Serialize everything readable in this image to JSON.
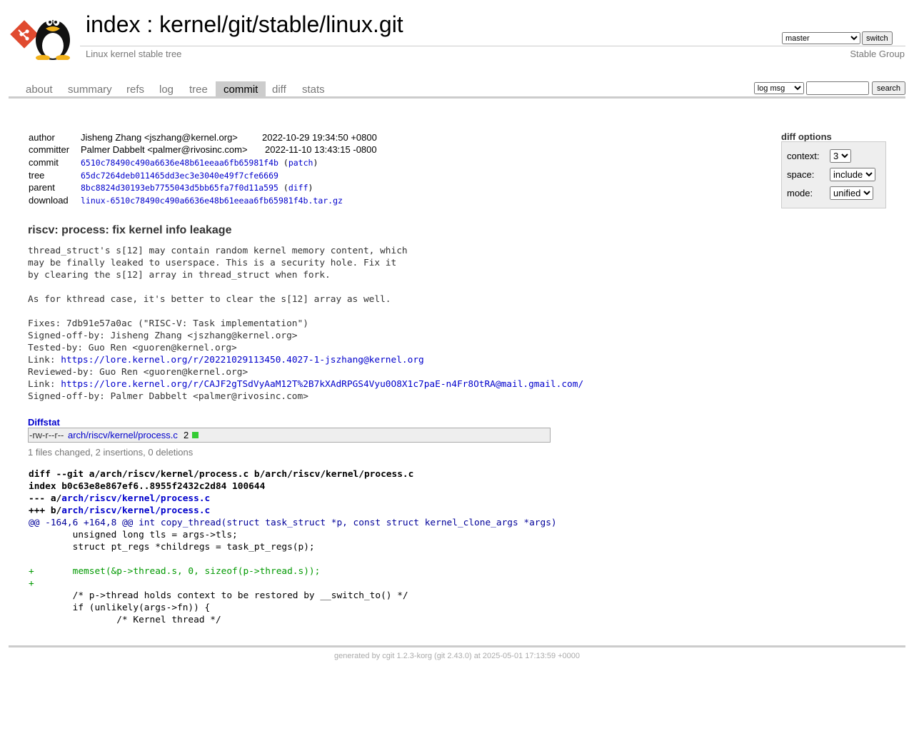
{
  "header": {
    "title_index": "index",
    "title_sep": " : ",
    "title_repo": "kernel/git/stable/linux.git",
    "subtitle": "Linux kernel stable tree",
    "owner": "Stable Group",
    "branch_selected": "master",
    "switch_label": "switch"
  },
  "tabs": [
    {
      "label": "about"
    },
    {
      "label": "summary"
    },
    {
      "label": "refs"
    },
    {
      "label": "log"
    },
    {
      "label": "tree"
    },
    {
      "label": "commit"
    },
    {
      "label": "diff"
    },
    {
      "label": "stats"
    }
  ],
  "active_tab": "commit",
  "search": {
    "select_value": "log msg",
    "query": "",
    "button_label": "search"
  },
  "commit_info": {
    "author_label": "author",
    "author": "Jisheng Zhang <jszhang@kernel.org>",
    "author_date": "2022-10-29 19:34:50 +0800",
    "committer_label": "committer",
    "committer": "Palmer Dabbelt <palmer@rivosinc.com>",
    "committer_date": "2022-11-10 13:43:15 -0800",
    "commit_label": "commit",
    "commit": "6510c78490c490a6636e48b61eeaa6fb65981f4b",
    "patch_link": "patch",
    "tree_label": "tree",
    "tree": "65dc7264deb011465dd3ec3e3040e49f7cfe6669",
    "parent_label": "parent",
    "parent": "8bc8824d30193eb7755043d5bb65fa7f0d11a595",
    "diff_link": "diff",
    "download_label": "download",
    "download": "linux-6510c78490c490a6636e48b61eeaa6fb65981f4b.tar.gz"
  },
  "diff_options": {
    "title": "diff options",
    "context_label": "context:",
    "context_value": "3",
    "space_label": "space:",
    "space_value": "include",
    "mode_label": "mode:",
    "mode_value": "unified"
  },
  "commit_subject": "riscv: process: fix kernel info leakage",
  "commit_message": {
    "line1": "thread_struct's s[12] may contain random kernel memory content, which",
    "line2": "may be finally leaked to userspace. This is a security hole. Fix it",
    "line3": "by clearing the s[12] array in thread_struct when fork.",
    "line4": "As for kthread case, it's better to clear the s[12] array as well.",
    "fixes": "Fixes: 7db91e57a0ac (\"RISC-V: Task implementation\")",
    "signed1": "Signed-off-by: Jisheng Zhang <jszhang@kernel.org>",
    "tested": "Tested-by: Guo Ren <guoren@kernel.org>",
    "link1_prefix": "Link: ",
    "link1": "https://lore.kernel.org/r/20221029113450.4027-1-jszhang@kernel.org",
    "reviewed": "Reviewed-by: Guo Ren <guoren@kernel.org>",
    "link2_prefix": "Link: ",
    "link2": "https://lore.kernel.org/r/CAJF2gTSdVyAaM12T%2B7kXAdRPGS4Vyu0O8X1c7paE-n4Fr8OtRA@mail.gmail.com/",
    "signed2": "Signed-off-by: Palmer Dabbelt <palmer@rivosinc.com>"
  },
  "diffstat": {
    "header": "Diffstat",
    "mode": "-rw-r--r--",
    "file": "arch/riscv/kernel/process.c",
    "count": "2",
    "summary": "1 files changed, 2 insertions, 0 deletions"
  },
  "diff": {
    "line1": "diff --git a/arch/riscv/kernel/process.c b/arch/riscv/kernel/process.c",
    "line2": "index b0c63e8e867ef6..8955f2432c2d84 100644",
    "line3_prefix": "--- a/",
    "line3_path": "arch/riscv/kernel/process.c",
    "line4_prefix": "+++ b/",
    "line4_path": "arch/riscv/kernel/process.c",
    "hunk": "@@ -164,6 +164,8 @@ int copy_thread(struct task_struct *p, const struct kernel_clone_args *args)",
    "ctx1": "        unsigned long tls = args->tls;",
    "ctx2": "        struct pt_regs *childregs = task_pt_regs(p);",
    "ctx3": "",
    "add1": "+       memset(&p->thread.s, 0, sizeof(p->thread.s));",
    "add2": "+",
    "ctx4": "        /* p->thread holds context to be restored by __switch_to() */",
    "ctx5": "        if (unlikely(args->fn)) {",
    "ctx6": "                /* Kernel thread */"
  },
  "footer": {
    "generated_by": "generated by ",
    "cgit": "cgit 1.2.3-korg",
    "git_open": " (",
    "git": "git 2.43.0",
    "git_close": ") at 2025-05-01 17:13:59 +0000"
  },
  "colors": {
    "link": "#0000cc",
    "active_tab_bg": "#cccccc",
    "diff_add": "#009900",
    "diff_hunk": "#000099",
    "diffstat_add_bar": "#33cc33"
  }
}
